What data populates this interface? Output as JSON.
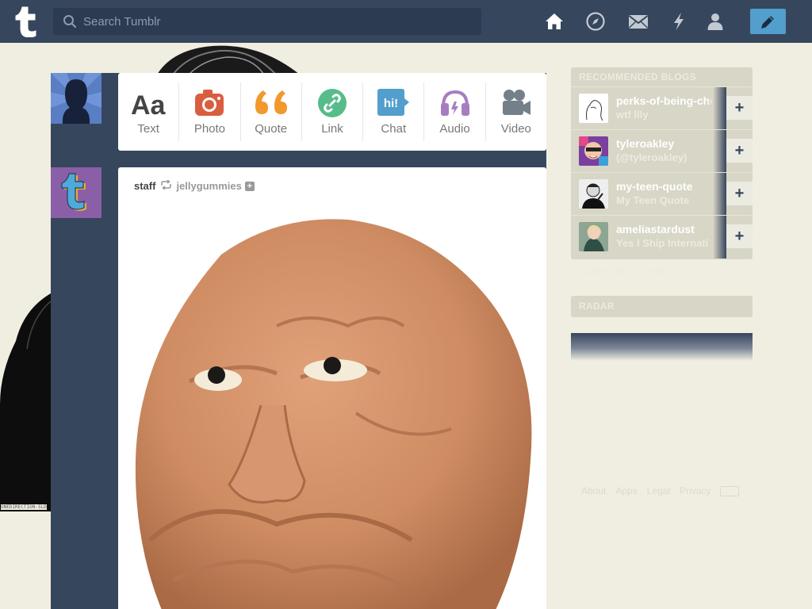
{
  "topbar": {
    "search_placeholder": "Search Tumblr",
    "nav_icons": [
      "home-icon",
      "compass-icon",
      "mail-icon",
      "lightning-icon",
      "person-icon"
    ],
    "compose_icon": "pencil-icon",
    "background_color": "#36465d",
    "accent_color": "#529ecc"
  },
  "composer": {
    "types": [
      {
        "icon": "text-icon",
        "label": "Text",
        "color": "#444444"
      },
      {
        "icon": "camera-icon",
        "label": "Photo",
        "color": "#d95e40"
      },
      {
        "icon": "quote-icon",
        "label": "Quote",
        "color": "#f2992e"
      },
      {
        "icon": "link-icon",
        "label": "Link",
        "color": "#56bc8a"
      },
      {
        "icon": "chat-icon",
        "label": "Chat",
        "color": "#529ecc"
      },
      {
        "icon": "headphones-icon",
        "label": "Audio",
        "color": "#a77dc2"
      },
      {
        "icon": "video-camera-icon",
        "label": "Video",
        "color": "#748089"
      }
    ]
  },
  "post": {
    "author": "staff",
    "source": "jellygummies",
    "follow_mini": "+"
  },
  "sidebar": {
    "recommended_title": "RECOMMENDED BLOGS",
    "blogs": [
      {
        "name": "perks-of-being-chr",
        "subtitle": "wtf lily",
        "follow": "+"
      },
      {
        "name": "tyleroakley",
        "subtitle": "(@tyleroakley)",
        "follow": "+"
      },
      {
        "name": "my-teen-quote",
        "subtitle": "My Teen Quote",
        "follow": "+"
      },
      {
        "name": "ameliastardust",
        "subtitle": "Yes I Ship Internati",
        "follow": "+"
      }
    ],
    "explore": "Explore all of Tumblr",
    "radar_title": "RADAR",
    "footer": [
      "About",
      "Apps",
      "Legal",
      "Privacy"
    ]
  },
  "decoration": {
    "caption": "ONEDIRECTION-SLD"
  }
}
